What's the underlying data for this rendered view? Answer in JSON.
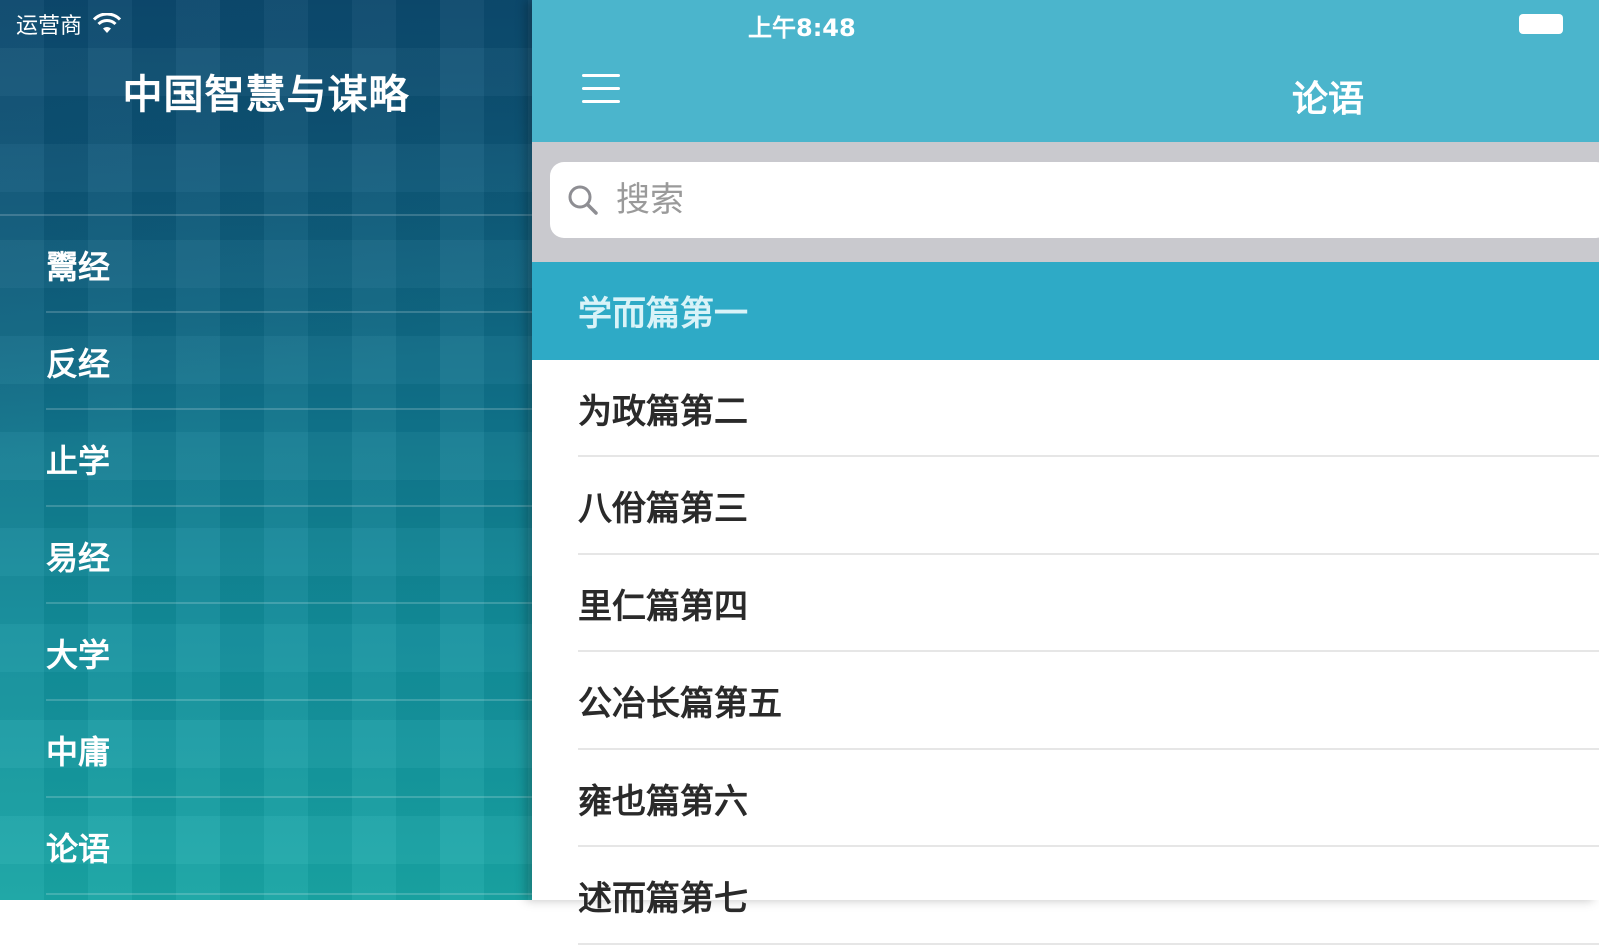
{
  "status_bar": {
    "carrier": "运营商",
    "time": "上午8:48"
  },
  "sidebar": {
    "title": "中国智慧与谋略",
    "items": [
      {
        "label": "鬻经"
      },
      {
        "label": "反经"
      },
      {
        "label": "止学"
      },
      {
        "label": "易经"
      },
      {
        "label": "大学"
      },
      {
        "label": "中庸"
      },
      {
        "label": "论语"
      }
    ]
  },
  "navbar": {
    "title": "论语"
  },
  "search": {
    "placeholder": "搜索"
  },
  "chapters": {
    "selected_index": 0,
    "items": [
      {
        "label": "学而篇第一"
      },
      {
        "label": "为政篇第二"
      },
      {
        "label": "八佾篇第三"
      },
      {
        "label": "里仁篇第四"
      },
      {
        "label": "公冶长篇第五"
      },
      {
        "label": "雍也篇第六"
      },
      {
        "label": "述而篇第七"
      }
    ]
  },
  "colors": {
    "navbar": "#4bb5cc",
    "selected_row": "#2eaac6",
    "search_bar_bg": "#c9c9ce"
  }
}
